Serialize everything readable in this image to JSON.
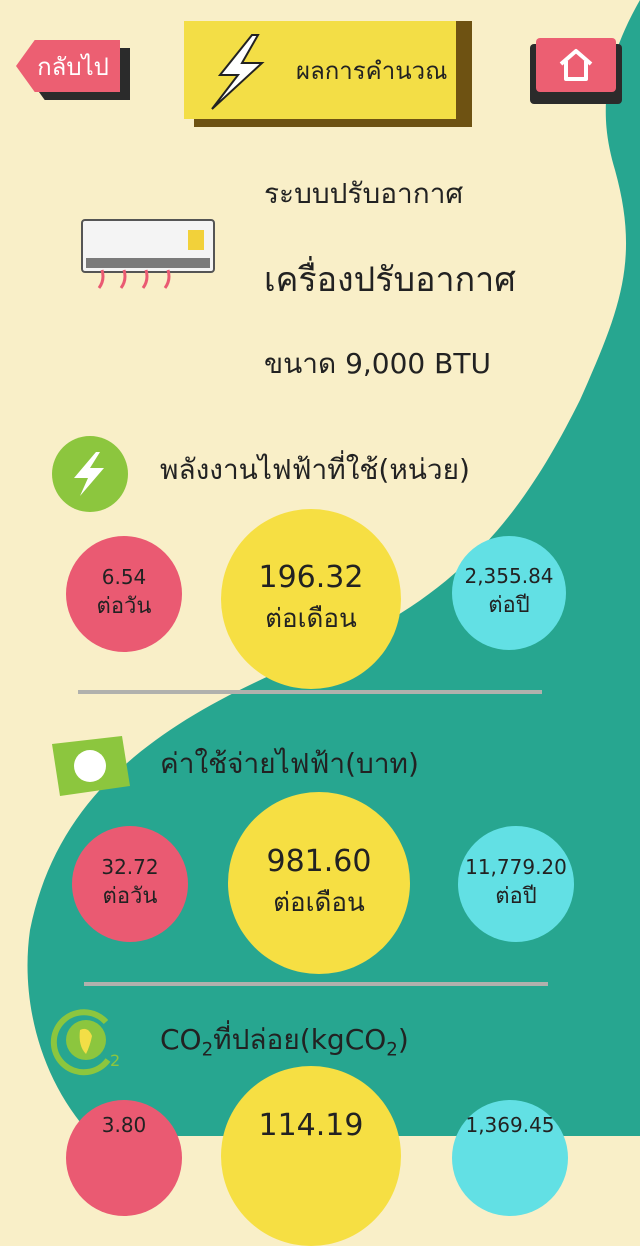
{
  "header": {
    "back_label": "กลับไป",
    "title": "ผลการคำนวณ"
  },
  "appliance": {
    "category": "ระบบปรับอากาศ",
    "name": "เครื่องปรับอากาศ",
    "size": "ขนาด 9,000 BTU"
  },
  "sections": [
    {
      "title": "พลังงานไฟฟ้าที่ใช้(หน่วย)",
      "per_day_value": "6.54",
      "per_day_label": "ต่อวัน",
      "per_month_value": "196.32",
      "per_month_label": "ต่อเดือน",
      "per_year_value": "2,355.84",
      "per_year_label": "ต่อปี"
    },
    {
      "title": "ค่าใช้จ่ายไฟฟ้า(บาท)",
      "per_day_value": "32.72",
      "per_day_label": "ต่อวัน",
      "per_month_value": "981.60",
      "per_month_label": "ต่อเดือน",
      "per_year_value": "11,779.20",
      "per_year_label": "ต่อปี"
    },
    {
      "title_prefix": "CO",
      "title_sub": "2",
      "title_mid": "ที่ปล่อย(kgCO",
      "title_sub2": "2",
      "title_suffix": ")",
      "per_day_value": "3.80",
      "per_month_value": "114.19",
      "per_year_value": "1,369.45"
    }
  ],
  "colors": {
    "background": "#f9efc8",
    "wave": "#27a690",
    "red": "#ea5a72",
    "yellow": "#f6df43",
    "cyan": "#62e0e4",
    "green": "#8cc63e"
  },
  "icons": [
    "lightning-icon",
    "home-icon",
    "air-conditioner-icon",
    "energy-icon",
    "money-icon",
    "co2-icon"
  ]
}
